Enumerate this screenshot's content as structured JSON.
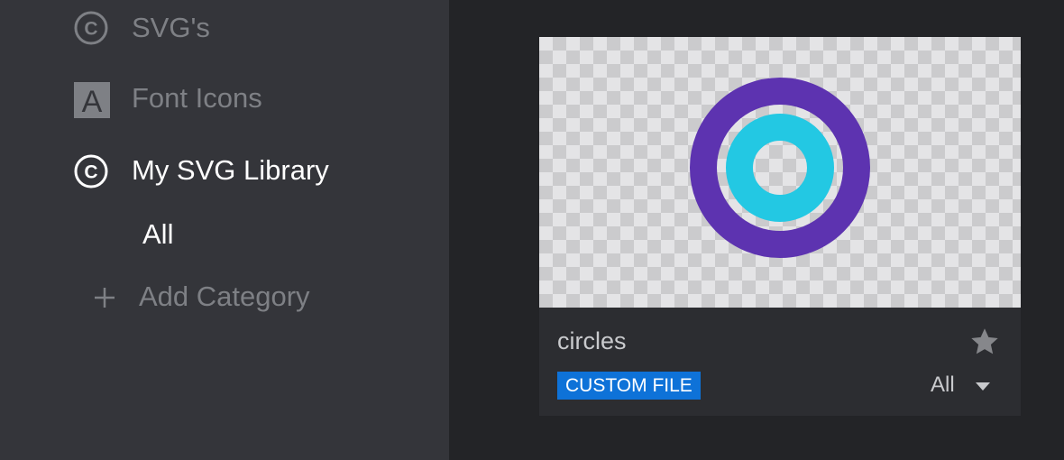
{
  "sidebar": {
    "items": [
      {
        "label": "SVG's",
        "icon": "copyright-circle-icon"
      },
      {
        "label": "Font Icons",
        "icon": "letter-a-square-icon"
      },
      {
        "label": "My SVG Library",
        "icon": "copyright-circle-icon",
        "active": true
      }
    ],
    "sub_items": [
      {
        "label": "All",
        "active": true
      }
    ],
    "add_category": {
      "label": "Add Category",
      "icon": "plus-icon"
    }
  },
  "asset_card": {
    "name": "circles",
    "badge": "CUSTOM FILE",
    "category": "All",
    "favorite_icon": "star-icon",
    "dropdown_icon": "caret-down-icon"
  },
  "colors": {
    "sidebar_bg": "#34353a",
    "main_bg": "#232427",
    "card_bg": "#2c2d31",
    "badge_bg": "#0e72d8",
    "outer_ring": "#5d33b0",
    "inner_ring": "#23c8e3"
  }
}
